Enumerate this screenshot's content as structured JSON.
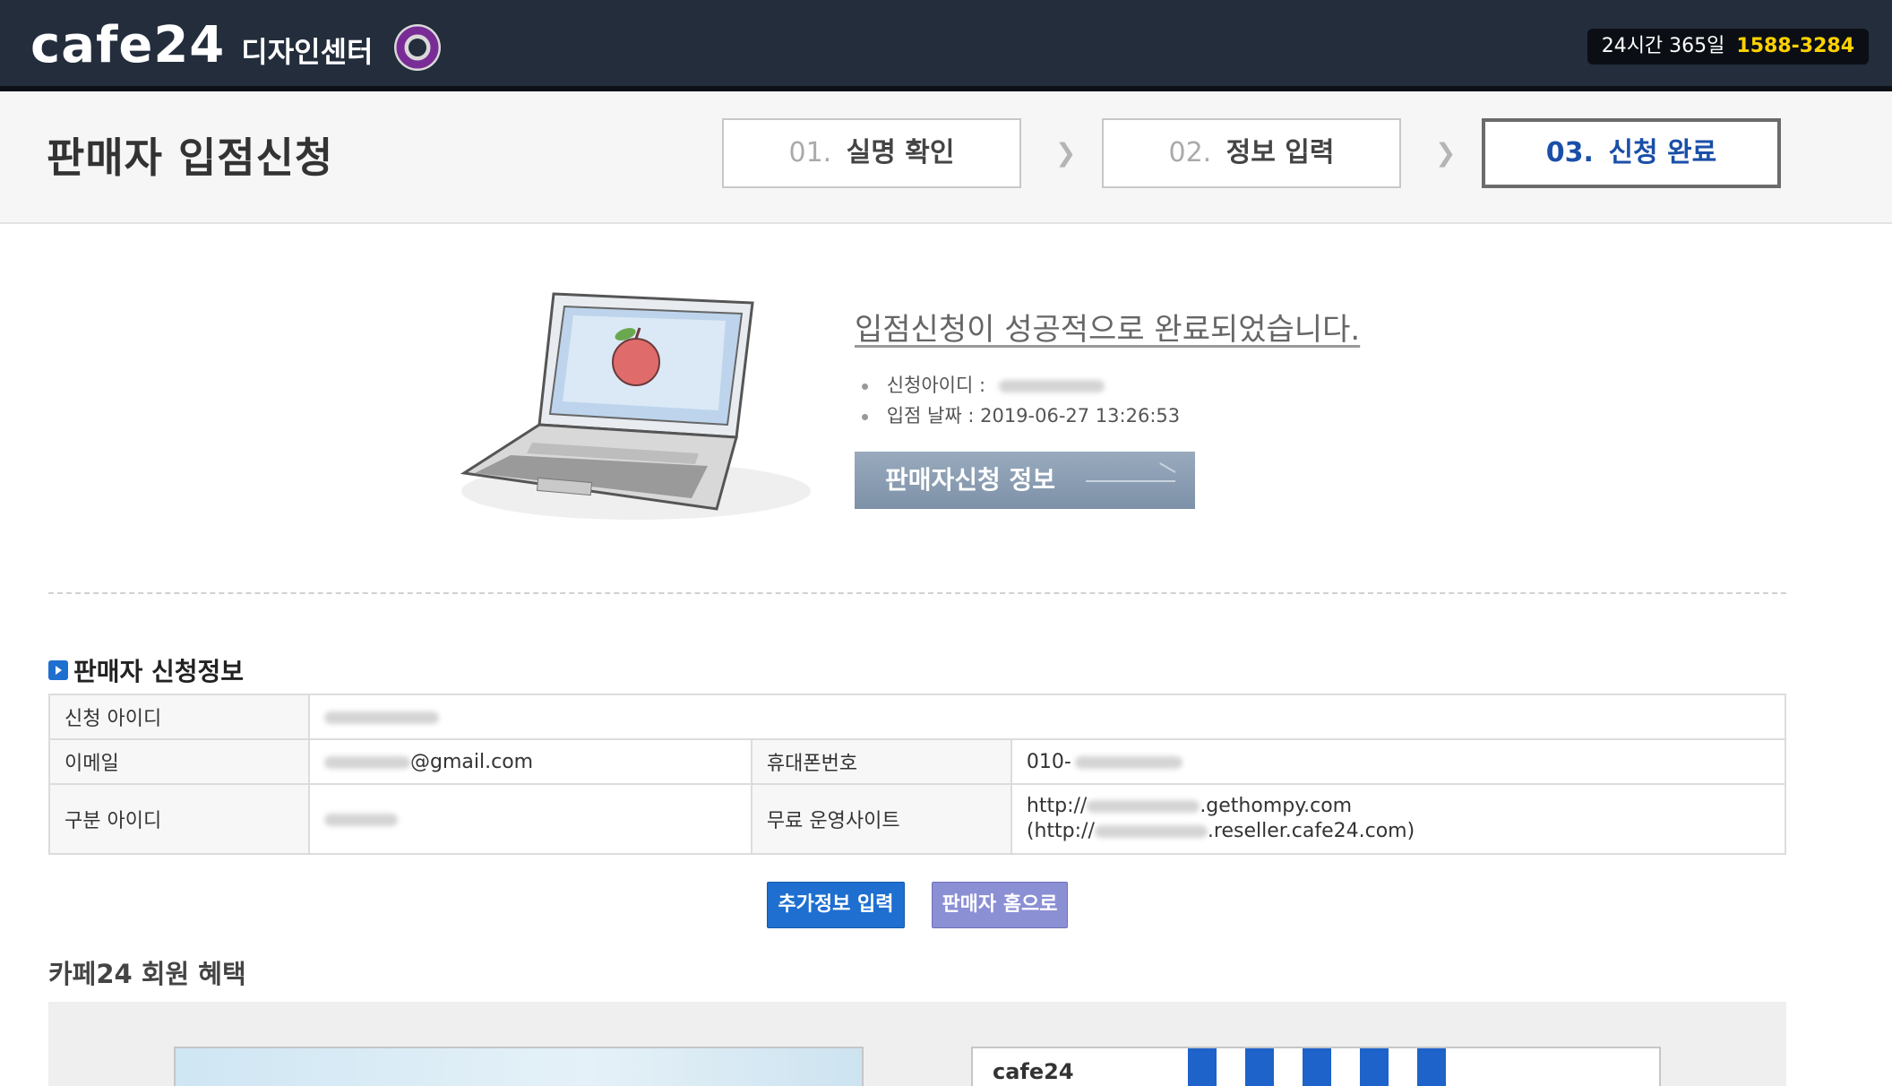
{
  "header": {
    "logo_text": "cafe24",
    "logo_sub": "디자인센터",
    "hotline_label": "24시간 365일",
    "hotline_number": "1588-3284"
  },
  "page": {
    "title": "판매자 입점신청",
    "steps": [
      {
        "no": "01.",
        "label": "실명 확인"
      },
      {
        "no": "02.",
        "label": "정보 입력"
      },
      {
        "no": "03.",
        "label": "신청 완료",
        "active": true
      }
    ]
  },
  "success": {
    "message": "입점신청이 성공적으로 완료되었습니다.",
    "id_label": "신청아이디 :",
    "date_label": "입점 날짜 :",
    "date_value": "2019-06-27 13:26:53",
    "button_label": "판매자신청 정보"
  },
  "seller_info": {
    "section_title": "판매자 신청정보",
    "labels": {
      "apply_id": "신청 아이디",
      "email": "이메일",
      "phone": "휴대폰번호",
      "sub_id": "구분 아이디",
      "free_site": "무료 운영사이트"
    },
    "values": {
      "email_suffix": "@gmail.com",
      "phone_prefix": "010-",
      "site_line1_prefix": "http://",
      "site_line1_suffix": ".gethompy.com",
      "site_line2_prefix": "(http://",
      "site_line2_suffix": ".reseller.cafe24.com)"
    }
  },
  "buttons": {
    "extra_info": "추가정보 입력",
    "seller_home": "판매자 홈으로"
  },
  "benefits": {
    "title": "카페24 회원 혜택",
    "right_card_brand": "cafe24"
  },
  "colors": {
    "header_bg": "#232d3b",
    "hotline_number": "#ffd200",
    "active_step": "#1a4fa8",
    "primary_button": "#1e6fd0",
    "secondary_button": "#8b8fd4"
  }
}
